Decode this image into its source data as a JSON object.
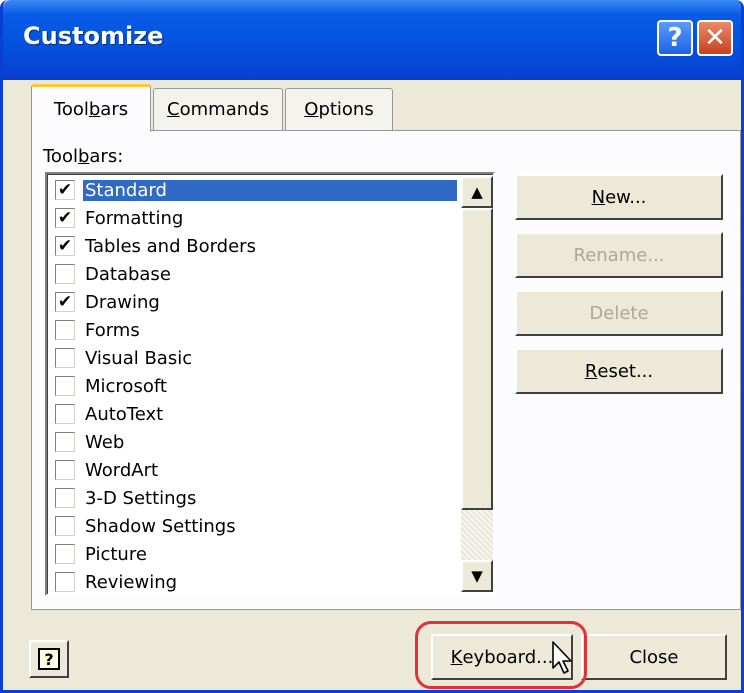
{
  "window": {
    "title": "Customize",
    "help_glyph": "?",
    "close_glyph": "✕",
    "colors": {
      "titlebar": "#0254e0",
      "dialog_bg": "#ece9d8",
      "selection": "#316ac5",
      "highlight_ring": "#e2303a",
      "active_tab_accent": "#ffc83c"
    }
  },
  "tabs": [
    {
      "pre": "Tool",
      "key": "b",
      "post": "ars",
      "active": true
    },
    {
      "pre": "",
      "key": "C",
      "post": "ommands",
      "active": false
    },
    {
      "pre": "",
      "key": "O",
      "post": "ptions",
      "active": false
    }
  ],
  "toolbars_label": {
    "pre": "Tool",
    "key": "b",
    "post": "ars:"
  },
  "toolbars": [
    {
      "label": "Standard",
      "checked": true,
      "selected": true
    },
    {
      "label": "Formatting",
      "checked": true,
      "selected": false
    },
    {
      "label": "Tables and Borders",
      "checked": true,
      "selected": false
    },
    {
      "label": "Database",
      "checked": false,
      "selected": false
    },
    {
      "label": "Drawing",
      "checked": true,
      "selected": false
    },
    {
      "label": "Forms",
      "checked": false,
      "selected": false
    },
    {
      "label": "Visual Basic",
      "checked": false,
      "selected": false
    },
    {
      "label": "Microsoft",
      "checked": false,
      "selected": false
    },
    {
      "label": "AutoText",
      "checked": false,
      "selected": false
    },
    {
      "label": "Web",
      "checked": false,
      "selected": false
    },
    {
      "label": "WordArt",
      "checked": false,
      "selected": false
    },
    {
      "label": "3-D Settings",
      "checked": false,
      "selected": false
    },
    {
      "label": "Shadow Settings",
      "checked": false,
      "selected": false
    },
    {
      "label": "Picture",
      "checked": false,
      "selected": false
    },
    {
      "label": "Reviewing",
      "checked": false,
      "selected": false
    }
  ],
  "check_glyph": "✔",
  "scroll_up_glyph": "▲",
  "scroll_down_glyph": "▼",
  "side_buttons": {
    "new": {
      "pre": "",
      "key": "N",
      "post": "ew..."
    },
    "rename": "Rename...",
    "delete": "Delete",
    "reset": {
      "pre": "",
      "key": "R",
      "post": "eset..."
    }
  },
  "footer": {
    "help_glyph": "?",
    "keyboard": {
      "pre": "",
      "key": "K",
      "post": "eyboard..."
    },
    "close": "Close"
  }
}
